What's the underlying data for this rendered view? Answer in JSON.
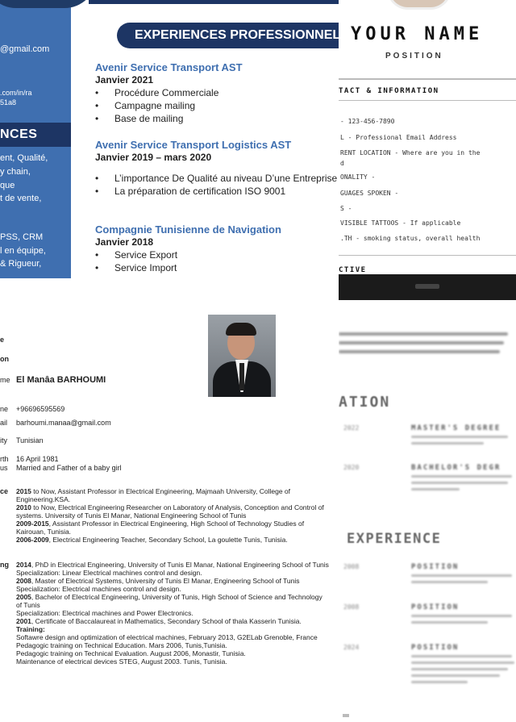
{
  "cv1": {
    "sidebar": {
      "email_fragment": "@gmail.com",
      "linkedin_line1": ".com/in/ra",
      "linkedin_line2": "51a8",
      "skills_heading": "NCES",
      "skills_lines": [
        "ent, Qualité,",
        "y chain,",
        "que",
        "t de vente,"
      ],
      "tools_lines": [
        "PSS, CRM",
        "l en équipe,",
        "& Rigueur,"
      ]
    },
    "section_title": "EXPERIENCES PROFESSIONNEL",
    "jobs": [
      {
        "company": "Avenir Service Transport AST",
        "date": "Janvier 2021",
        "tasks": [
          "Procédure Commerciale",
          "Campagne mailing",
          "Base de mailing"
        ]
      },
      {
        "company": "Avenir Service Transport Logistics AST",
        "date": "Janvier 2019 – mars 2020",
        "tasks": [
          "L’importance De Qualité au niveau D’une Entreprise",
          "La préparation de certification ISO 9001"
        ]
      },
      {
        "company": "Compagnie Tunisienne de Navigation",
        "date": "Janvier 2018",
        "tasks": [
          "Service Export",
          "Service Import"
        ]
      }
    ]
  },
  "cv2": {
    "name": "YOUR NAME",
    "position": "POSITION",
    "contact_heading": "TACT & INFORMATION",
    "info_lines": [
      "- 123-456-7890",
      "L - Professional Email Address",
      "RENT LOCATION - Where are you in the",
      "d",
      "ONALITY -",
      "GUAGES SPOKEN -",
      "S -",
      "VISIBLE TATTOOS - If applicable",
      ".TH - smoking status, overall health"
    ],
    "objective_heading": "CTIVE"
  },
  "cv3": {
    "labels": [
      "e",
      "on",
      "me",
      "ne",
      "ail",
      "ity",
      "rth",
      "us",
      "ce",
      "ng"
    ],
    "name": "El Manâa BARHOUMI",
    "phone": "+96696595569",
    "email": "barhoumi.manaa@gmail.com",
    "nationality": "Tunisian",
    "birth": "16 April 1981",
    "status": "Married and Father of a  baby girl",
    "experience": [
      {
        "bold": "2015",
        "text": " to Now, Assistant Professor in Electrical Engineering, Majmaah University, College of"
      },
      {
        "bold": "",
        "text": "Engineering.KSA."
      },
      {
        "bold": "2010",
        "text": " to Now, Electrical Engineering Researcher on Laboratory of Analysis, Conception and Control of"
      },
      {
        "bold": "",
        "text": "systems. University of Tunis El Manar,  National Engineering School of Tunis"
      },
      {
        "bold": "2009-2015",
        "text": ", Assistant Professor in Electrical Engineering, High School of Technology Studies of"
      },
      {
        "bold": "",
        "text": "Kairouan, Tunisia."
      },
      {
        "bold": "2006-2009",
        "text": ", Electrical Engineering Teacher, Secondary School, La goulette Tunis, Tunisia."
      }
    ],
    "training": [
      {
        "bold": "2014",
        "text": ", PhD in Electrical Engineering, University of Tunis El Manar,  National Engineering School of Tunis"
      },
      {
        "bold": "",
        "text": "  Specialization: Linear Electrical machines control and design."
      },
      {
        "bold": "2008",
        "text": ", Master of Electrical Systems, University of Tunis El Manar, Engineering School of Tunis"
      },
      {
        "bold": "",
        "text": "  Specialization: Electrical machines control and design."
      },
      {
        "bold": "2005",
        "text": ", Bachelor of Electrical Engineering, University of Tunis, High School of Science and Technology"
      },
      {
        "bold": "",
        "text": "of Tunis"
      },
      {
        "bold": "",
        "text": "  Specialization: Electrical machines and Power Electronics."
      },
      {
        "bold": "2001",
        "text": ", Certificate of Baccalaureat in Mathematics, Secondary School of thala Kasserin Tunisia."
      },
      {
        "bold": "Training:",
        "text": ""
      },
      {
        "bold": "",
        "text": "Softawre design and optimization of electrical machines, February 2013, G2ELab Grenoble, France"
      },
      {
        "bold": "",
        "text": "Pedagogic training on Technical Education. Mars 2006, Tunis,Tunisia."
      },
      {
        "bold": "",
        "text": "Pedagogic training on Technical Evaluation. August 2006, Monastir, Tunisia."
      },
      {
        "bold": "",
        "text": "Maintenance of electrical devices STEG, August 2003. Tunis, Tunisia."
      }
    ]
  },
  "cv4": {
    "education_heading": "ATION",
    "experience_heading": "EXPERIENCE",
    "education": [
      {
        "year": "2022",
        "title": "MASTER'S DEGREE"
      },
      {
        "year": "2020",
        "title": "BACHELOR'S DEGR"
      }
    ],
    "experience": [
      {
        "year": "2008",
        "title": "POSITION"
      },
      {
        "year": "2008",
        "title": "POSITION"
      },
      {
        "year": "2024",
        "title": "POSITION"
      }
    ]
  }
}
